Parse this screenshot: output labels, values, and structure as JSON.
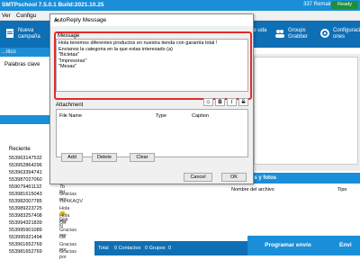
{
  "app": {
    "title": "SMTPschool 7.5.0.1 Build:2021.10.25",
    "remaining_days": "337 Remaining days",
    "status": "Ready"
  },
  "menu": [
    "Ver",
    "Configu"
  ],
  "toolbar": {
    "nueva_campana": "Nueva campaña",
    "grupos_contacts": "os de\nuda",
    "groups_grabber": "Groups Grabber",
    "configuraciones": "Configuraci ones"
  },
  "left": {
    "header": "...itico",
    "palabras": "Palabras clave",
    "recent_label": "Reciente",
    "rows": [
      {
        "phone": "553963147532",
        "msg": ""
      },
      {
        "phone": "553952864296",
        "msg": ""
      },
      {
        "phone": "553963394741",
        "msg": ""
      },
      {
        "phone": "553987027060",
        "msg": ""
      },
      {
        "phone": "559079461132",
        "msg": "7b 8d..."
      },
      {
        "phone": "553981615043",
        "msg": "Gracias por"
      },
      {
        "phone": "553982007785",
        "msg": "7b/4KAQV"
      },
      {
        "phone": "553989223725",
        "msg": "Hola 😊 Gra"
      },
      {
        "phone": "553983257408",
        "msg": "Hola soy N"
      },
      {
        "phone": "553994321839",
        "msg": "Ok"
      },
      {
        "phone": "553995901089",
        "msg": "Gracias por"
      },
      {
        "phone": "553995921494",
        "msg": "Ok"
      },
      {
        "phone": "553961652769",
        "msg": "Gracias por"
      },
      {
        "phone": "553981652769",
        "msg": "Gracias por"
      }
    ]
  },
  "dialog": {
    "title": "AutoReply Message",
    "message_label": "Message",
    "message_text": "Hola tenemos diferentes productos en nuestra tienda con garantía total !\nEnvianos la categoria en la que estas interesado (a)\n\"Bicletas\"\n\"Impresoras\"\n\"Mesas\"",
    "format_buttons": [
      "☺",
      "B",
      "I",
      "S"
    ],
    "attachment_label": "Attachment",
    "columns": [
      "File Name",
      "Type",
      "Caption"
    ],
    "add": "Add",
    "delete": "Delete",
    "clear": "Clear",
    "cancel": "Cancel",
    "ok": "OK"
  },
  "right": {
    "archivos_header": "Archivos y fotos",
    "col_nombre": "Nombre del archivo",
    "col_tipo": "Tipo"
  },
  "footer": {
    "total": "Total",
    "contactos": "0  Contactos",
    "grupos": "0  Grupos",
    "grupos_count": "0",
    "programar": "Programar envío",
    "enviar": "Envi"
  }
}
